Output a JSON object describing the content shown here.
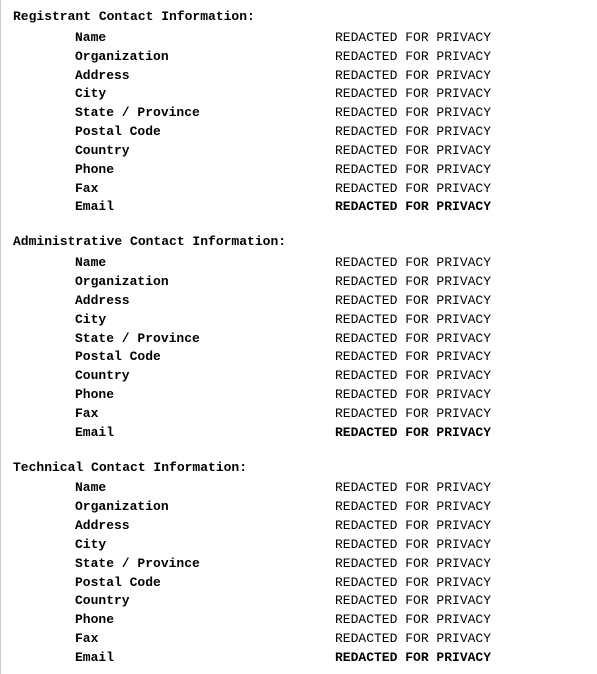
{
  "sections": [
    {
      "title": "Registrant Contact Information:",
      "rows": [
        {
          "label": "Name",
          "value": "REDACTED FOR PRIVACY",
          "bold": false
        },
        {
          "label": "Organization",
          "value": "REDACTED FOR PRIVACY",
          "bold": false
        },
        {
          "label": "Address",
          "value": "REDACTED FOR PRIVACY",
          "bold": false
        },
        {
          "label": "City",
          "value": "REDACTED FOR PRIVACY",
          "bold": false
        },
        {
          "label": "State / Province",
          "value": "REDACTED FOR PRIVACY",
          "bold": false
        },
        {
          "label": "Postal Code",
          "value": "REDACTED FOR PRIVACY",
          "bold": false
        },
        {
          "label": "Country",
          "value": "REDACTED FOR PRIVACY",
          "bold": false
        },
        {
          "label": "Phone",
          "value": "REDACTED FOR PRIVACY",
          "bold": false
        },
        {
          "label": "Fax",
          "value": "REDACTED FOR PRIVACY",
          "bold": false
        },
        {
          "label": "Email",
          "value": "REDACTED FOR PRIVACY",
          "bold": true
        }
      ]
    },
    {
      "title": "Administrative Contact Information:",
      "rows": [
        {
          "label": "Name",
          "value": "REDACTED FOR PRIVACY",
          "bold": false
        },
        {
          "label": "Organization",
          "value": "REDACTED FOR PRIVACY",
          "bold": false
        },
        {
          "label": "Address",
          "value": "REDACTED FOR PRIVACY",
          "bold": false
        },
        {
          "label": "City",
          "value": "REDACTED FOR PRIVACY",
          "bold": false
        },
        {
          "label": "State / Province",
          "value": "REDACTED FOR PRIVACY",
          "bold": false
        },
        {
          "label": "Postal Code",
          "value": "REDACTED FOR PRIVACY",
          "bold": false
        },
        {
          "label": "Country",
          "value": "REDACTED FOR PRIVACY",
          "bold": false
        },
        {
          "label": "Phone",
          "value": "REDACTED FOR PRIVACY",
          "bold": false
        },
        {
          "label": "Fax",
          "value": "REDACTED FOR PRIVACY",
          "bold": false
        },
        {
          "label": "Email",
          "value": "REDACTED FOR PRIVACY",
          "bold": true
        }
      ]
    },
    {
      "title": "Technical Contact Information:",
      "rows": [
        {
          "label": "Name",
          "value": "REDACTED FOR PRIVACY",
          "bold": false
        },
        {
          "label": "Organization",
          "value": "REDACTED FOR PRIVACY",
          "bold": false
        },
        {
          "label": "Address",
          "value": "REDACTED FOR PRIVACY",
          "bold": false
        },
        {
          "label": "City",
          "value": "REDACTED FOR PRIVACY",
          "bold": false
        },
        {
          "label": "State / Province",
          "value": "REDACTED FOR PRIVACY",
          "bold": false
        },
        {
          "label": "Postal Code",
          "value": "REDACTED FOR PRIVACY",
          "bold": false
        },
        {
          "label": "Country",
          "value": "REDACTED FOR PRIVACY",
          "bold": false
        },
        {
          "label": "Phone",
          "value": "REDACTED FOR PRIVACY",
          "bold": false
        },
        {
          "label": "Fax",
          "value": "REDACTED FOR PRIVACY",
          "bold": false
        },
        {
          "label": "Email",
          "value": "REDACTED FOR PRIVACY",
          "bold": true
        }
      ]
    }
  ]
}
